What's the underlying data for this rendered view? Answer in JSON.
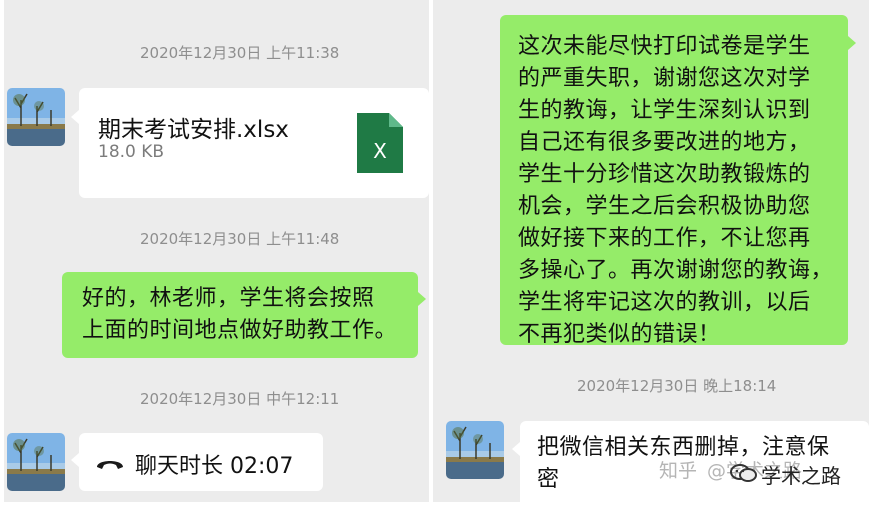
{
  "left_panel": {
    "timestamps": [
      "2020年12月30日 上午11:38",
      "2020年12月30日 上午11:48",
      "2020年12月30日 中午12:11"
    ],
    "file_message": {
      "file_name": "期末考试安排.xlsx",
      "file_size": "18.0 KB",
      "icon": "excel-file-icon",
      "icon_letter": "X",
      "icon_color": "#1f7a45"
    },
    "reply_message": {
      "lines": [
        "好的，林老师，学生将会按照",
        "上面的时间地点做好助教工作。"
      ]
    },
    "call_message": {
      "icon": "phone-hangup-icon",
      "text": "聊天时长 02:07"
    }
  },
  "right_panel": {
    "apology_message": {
      "lines": [
        "这次未能尽快打印试卷是学生",
        "的严重失职，谢谢您这次对学",
        "生的教诲，让学生深刻认识到",
        "自己还有很多要改进的地方，",
        "学生十分珍惜这次助教锻炼的",
        "机会，学生之后会积极协助您",
        "做好接下来的工作，不让您再",
        "多操心了。再次谢谢您的教诲，",
        "学生将牢记这次的教训，以后",
        "不再犯类似的错误！"
      ]
    },
    "timestamp": "2020年12月30日 晚上18:14",
    "teacher_message": {
      "lines": [
        "把微信相关东西删掉，注意保",
        "密"
      ]
    }
  },
  "watermark": {
    "zhihu": "知乎",
    "account": "@学术之路",
    "brand": "学术之路"
  },
  "colors": {
    "chat_background": "#ececec",
    "sent_bubble": "#95ec69",
    "received_bubble": "#ffffff",
    "timestamp_text": "#8e8e8e"
  }
}
